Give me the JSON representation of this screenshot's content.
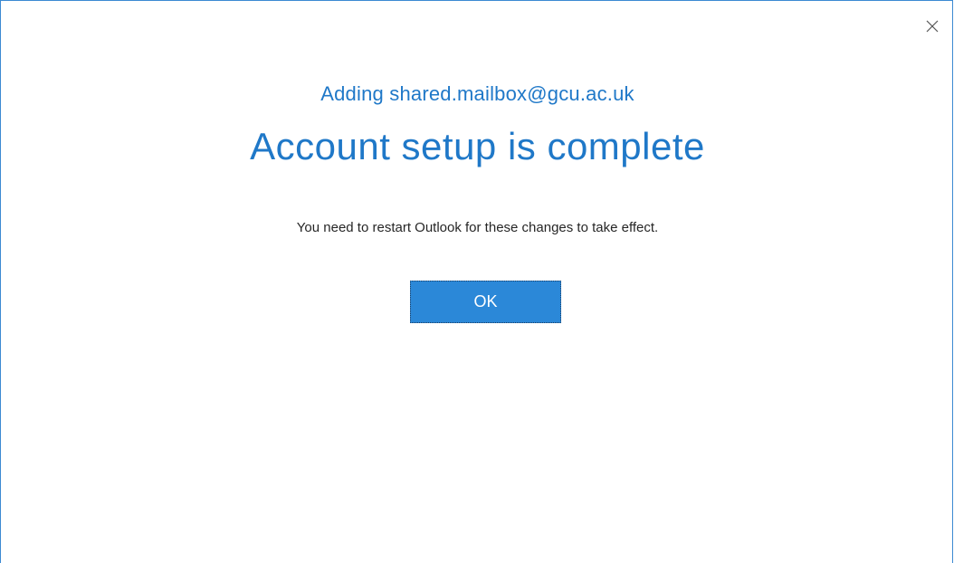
{
  "dialog": {
    "close_icon": "close-icon",
    "subtitle": "Adding shared.mailbox@gcu.ac.uk",
    "title": "Account setup is complete",
    "message": "You need to restart Outlook for these changes to take effect.",
    "ok_label": "OK"
  },
  "colors": {
    "accent": "#1f78c8",
    "button": "#2b88d8",
    "border": "#3c8ad2",
    "text": "#262626"
  }
}
